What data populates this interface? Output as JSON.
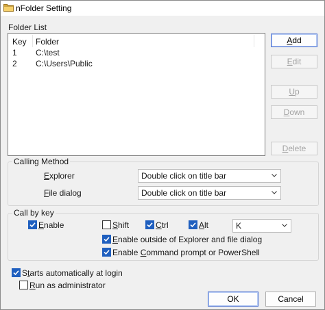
{
  "window": {
    "title": "nFolder Setting",
    "icon": "folder-icon"
  },
  "folder_list": {
    "label": "Folder List",
    "columns": [
      "Key",
      "Folder"
    ],
    "rows": [
      {
        "key": "1",
        "folder": "C:\\test"
      },
      {
        "key": "2",
        "folder": "C:\\Users\\Public"
      }
    ]
  },
  "side_buttons": {
    "add": {
      "pre": "",
      "acc": "A",
      "post": "dd",
      "enabled": true
    },
    "edit": {
      "pre": "",
      "acc": "E",
      "post": "dit",
      "enabled": false
    },
    "up": {
      "pre": "",
      "acc": "U",
      "post": "p",
      "enabled": false
    },
    "down": {
      "pre": "",
      "acc": "D",
      "post": "own",
      "enabled": false
    },
    "delete": {
      "pre": "",
      "acc": "D",
      "post": "elete",
      "enabled": false
    }
  },
  "calling_method": {
    "title": "Calling Method",
    "explorer": {
      "pre": "",
      "acc": "E",
      "post": "xplorer",
      "value": "Double click on title bar"
    },
    "file_dialog": {
      "pre": "",
      "acc": "F",
      "post": "ile dialog",
      "value": "Double click on title bar"
    }
  },
  "call_by_key": {
    "title": "Call by key",
    "enable": {
      "pre": "",
      "acc": "E",
      "post": "nable",
      "checked": true
    },
    "shift": {
      "pre": "",
      "acc": "S",
      "post": "hift",
      "checked": false
    },
    "ctrl": {
      "pre": "",
      "acc": "C",
      "post": "trl",
      "checked": true
    },
    "alt": {
      "pre": "",
      "acc": "A",
      "post": "lt",
      "checked": true
    },
    "key_value": "K",
    "outside": {
      "pre": "",
      "acc": "E",
      "post": "nable outside of Explorer and file dialog",
      "checked": true
    },
    "cmd": {
      "pre": "Enable ",
      "acc": "C",
      "post": "ommand prompt or PowerShell",
      "checked": true
    }
  },
  "startup": {
    "pre": "S",
    "acc": "t",
    "post": "arts automatically at login",
    "checked": true
  },
  "run_admin": {
    "pre": "",
    "acc": "R",
    "post": "un as administrator",
    "checked": false
  },
  "footer": {
    "ok": "OK",
    "cancel": "Cancel"
  },
  "colors": {
    "accent": "#1f5fbf",
    "disabled_text": "#a3a3a3"
  }
}
